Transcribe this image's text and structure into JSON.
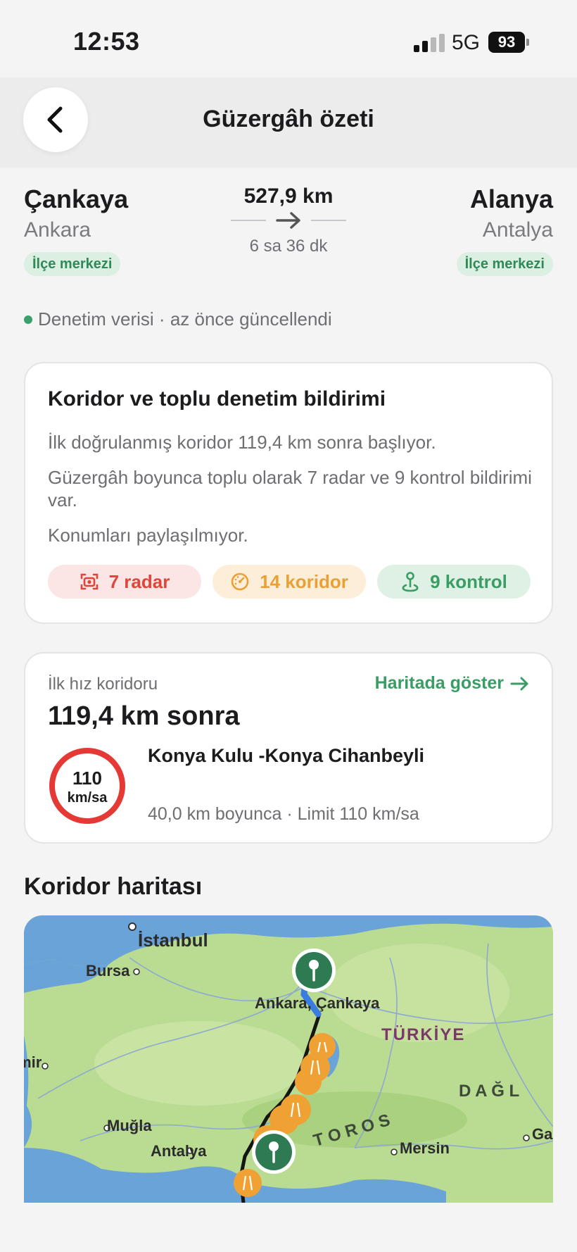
{
  "status_bar": {
    "time": "12:53",
    "network": "5G",
    "battery": "93"
  },
  "header": {
    "title": "Güzergâh özeti",
    "back_icon": "chevron-left-icon"
  },
  "route": {
    "origin": {
      "name": "Çankaya",
      "sub": "Ankara",
      "badge": "İlçe merkezi"
    },
    "destination": {
      "name": "Alanya",
      "sub": "Antalya",
      "badge": "İlçe merkezi"
    },
    "distance": "527,9 km",
    "duration": "6 sa 36 dk"
  },
  "sync": {
    "text": "Denetim verisi · az önce güncellendi",
    "color": "#3aa06b"
  },
  "notice_card": {
    "title": "Koridor ve toplu denetim bildirimi",
    "p1": "İlk doğrulanmış koridor 119,4 km sonra başlıyor.",
    "p2": "Güzergâh boyunca toplu olarak 7 radar ve 9 kontrol bildirimi var.",
    "p3": "Konumları paylaşılmıyor.",
    "pills": {
      "radar": {
        "label": "7 radar",
        "icon": "radar-camera-icon",
        "color": "#e0453a"
      },
      "corridor": {
        "label": "14 koridor",
        "icon": "speedometer-icon",
        "color": "#eba033"
      },
      "control": {
        "label": "9 kontrol",
        "icon": "checkpoint-pin-icon",
        "color": "#3a9d63"
      }
    }
  },
  "corridor_card": {
    "label": "İlk hız koridoru",
    "link": "Haritada göster",
    "distance": "119,4 km sonra",
    "speed_value": "110",
    "speed_unit": "km/sa",
    "name": "Konya Kulu -Konya Cihanbeyli",
    "meta": "40,0 km boyunca · Limit 110 km/sa"
  },
  "map_section": {
    "title": "Koridor haritası",
    "labels": {
      "istanbul": "İstanbul",
      "bursa": "Bursa",
      "ankara": "Ankara, Çankaya",
      "turkiye": "TÜRKİYE",
      "izmir": "İzmir",
      "mugla": "Muğla",
      "antalya": "Antalya",
      "toros": "T O R O S",
      "dag": "D A Ğ L",
      "mersin": "Mersin",
      "gaz": "Gaz"
    }
  }
}
